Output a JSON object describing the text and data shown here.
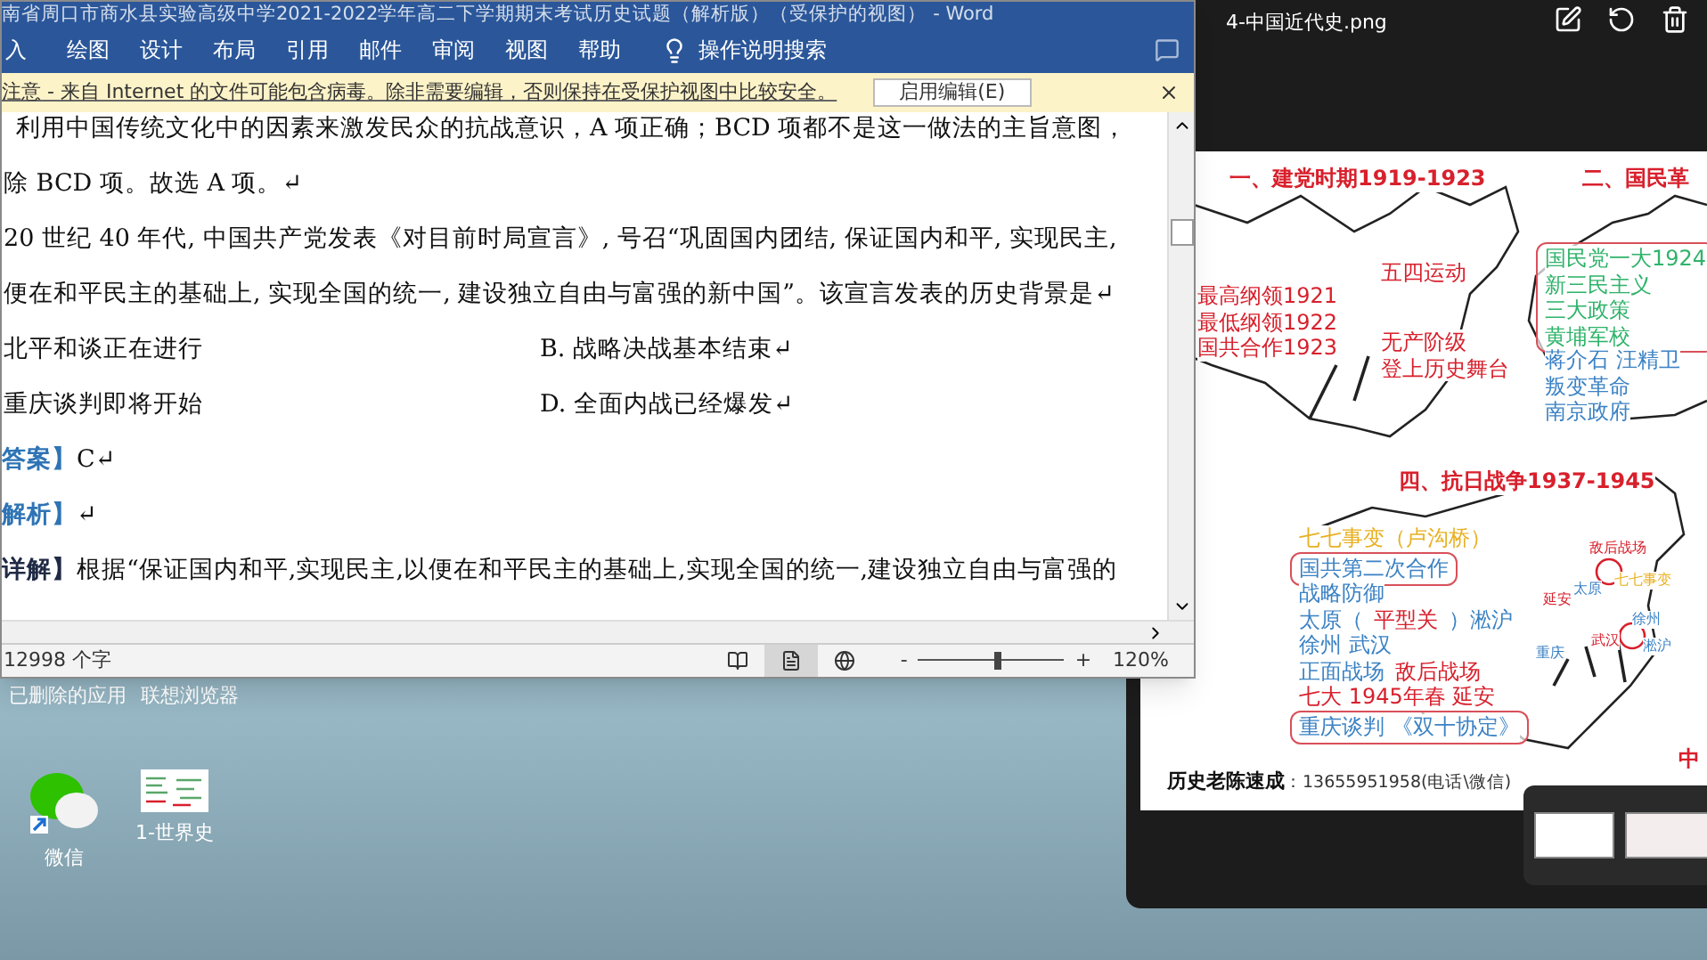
{
  "word_window": {
    "title": "南省周口市商水县实验高级中学2021-2022学年高二下学期期末考试历史试题（解析版）（受保护的视图） - Word",
    "ribbon_tabs": [
      "入",
      "绘图",
      "设计",
      "布局",
      "引用",
      "邮件",
      "审阅",
      "视图",
      "帮助"
    ],
    "search_label": "操作说明搜索",
    "protected_bar": {
      "message": "注意 - 来自 Internet 的文件可能包含病毒。除非需要编辑，否则保持在受保护视图中比较安全。",
      "button": "启用编辑(E)"
    },
    "document": {
      "lines": [
        {
          "kind": "text",
          "text": "利用中国传统文化中的因素来激发民众的抗战意识，A 项正确；BCD 项都不是这一做法的主旨意图，"
        },
        {
          "kind": "text",
          "text": "除 BCD 项。故选 A 项。↵"
        },
        {
          "kind": "text",
          "text": "20 世纪 40 年代, 中国共产党发表《对目前时局宣言》, 号召“巩固国内团结, 保证国内和平, 实现民主,"
        },
        {
          "kind": "text",
          "text": "便在和平民主的基础上, 实现全国的统一, 建设独立自由与富强的新中国”。该宣言发表的历史背景是↵"
        },
        {
          "kind": "options",
          "left": "北平和谈正在进行",
          "right": "B. 战略决战基本结束↵"
        },
        {
          "kind": "options",
          "left": "重庆谈判即将开始",
          "right": "D. 全面内战已经爆发↵"
        },
        {
          "kind": "labeled",
          "label": "答案】",
          "color": "#2e74b5",
          "text": "C↵"
        },
        {
          "kind": "labeled",
          "label": "解析】",
          "color": "#2e74b5",
          "text": "↵"
        },
        {
          "kind": "labeled",
          "label": "详解】",
          "color": "#1f2a44",
          "text": "根据“保证国内和平,实现民主,以便在和平民主的基础上,实现全国的统一,建设独立自由与富强的"
        }
      ]
    },
    "status_bar": {
      "word_count": "12998 个字",
      "views": [
        {
          "selected": false
        },
        {
          "selected": true
        },
        {
          "selected": false
        }
      ],
      "zoom_minus": "-",
      "zoom": {
        "level": 0.54
      },
      "zoom_plus": "+",
      "zoom_reading": "120%"
    }
  },
  "desktop": {
    "top_labels": [
      "已删除的应用",
      "联想浏览器"
    ],
    "icons": [
      {
        "kind": "chat",
        "label": "微信"
      },
      {
        "kind": "thumbnail",
        "label": "1-世界史"
      }
    ]
  },
  "photo_viewer": {
    "title": "4-中国近代史.png",
    "image": {
      "groups": [
        {
          "kind": "title",
          "lines": [
            [
              {
                "text": "一、建党时期1919-1923",
                "color": "#d8202c"
              }
            ]
          ]
        },
        {
          "kind": "title",
          "lines": [
            [
              {
                "text": "二、国民革",
                "color": "#d8202c"
              }
            ]
          ]
        },
        {
          "kind": "plain",
          "lines": [
            [
              {
                "text": "五四运动",
                "color": "#d8202c"
              }
            ]
          ]
        },
        {
          "kind": "plain",
          "lines": [
            [
              {
                "text": "最高纲领1921",
                "color": "#d8202c"
              }
            ],
            [
              {
                "text": "最低纲领1922",
                "color": "#d8202c"
              }
            ],
            [
              {
                "text": "国共合作1923",
                "color": "#d8202c"
              }
            ]
          ]
        },
        {
          "kind": "plain",
          "lines": [
            [
              {
                "text": "无产阶级",
                "color": "#d8202c"
              }
            ],
            [
              {
                "text": "登上历史舞台",
                "color": "#d8202c"
              }
            ]
          ]
        },
        {
          "kind": "boxed",
          "lines": [
            [
              {
                "text": "国民党一大1924",
                "color": "#2fb36a"
              }
            ],
            [
              {
                "text": "新三民主义",
                "color": "#2fb36a"
              }
            ],
            [
              {
                "text": "三大政策",
                "color": "#2fb36a"
              }
            ],
            [
              {
                "text": "黄埔军校",
                "color": "#2fb36a"
              }
            ]
          ]
        },
        {
          "kind": "plain",
          "lines": [
            [
              {
                "text": "蒋介石 汪精卫",
                "color": "#3b82c4"
              }
            ],
            [
              {
                "text": "叛变革命",
                "color": "#3b82c4"
              }
            ],
            [
              {
                "text": "南京政府",
                "color": "#3b82c4"
              }
            ]
          ]
        },
        {
          "kind": "title",
          "lines": [
            [
              {
                "text": "四、抗日战争1937-1945",
                "color": "#d8202c"
              }
            ]
          ]
        },
        {
          "kind": "plain",
          "lines": [
            [
              {
                "text": "七七事变（卢沟桥）",
                "color": "#e8b020"
              }
            ]
          ]
        },
        {
          "kind": "boxed",
          "lines": [
            [
              {
                "text": "国共第二次合作",
                "color": "#3b82c4"
              }
            ]
          ]
        },
        {
          "kind": "plain",
          "lines": [
            [
              {
                "text": "战略防御",
                "color": "#3b82c4"
              }
            ],
            [
              {
                "text": "太原（",
                "color": "#3b82c4"
              },
              {
                "text": "平型关",
                "color": "#d8202c"
              },
              {
                "text": "）淞沪",
                "color": "#3b82c4"
              }
            ],
            [
              {
                "text": "徐州  武汉",
                "color": "#3b82c4"
              }
            ],
            [
              {
                "text": "正面战场",
                "color": "#3b82c4"
              },
              {
                "text": "敌后战场",
                "color": "#d8202c"
              }
            ],
            [
              {
                "text": "七大  1945年春  延安",
                "color": "#d8202c"
              }
            ]
          ]
        },
        {
          "kind": "boxed",
          "lines": [
            [
              {
                "text": "重庆谈判  《双十协定》",
                "color": "#3b82c4"
              }
            ]
          ]
        },
        {
          "kind": "small",
          "lines": [
            [
              {
                "text": "敌后战场",
                "color": "#d8202c"
              }
            ]
          ]
        },
        {
          "kind": "small",
          "lines": [
            [
              {
                "text": "太原",
                "color": "#3b82c4"
              }
            ]
          ]
        },
        {
          "kind": "small",
          "lines": [
            [
              {
                "text": "延安",
                "color": "#d8202c"
              }
            ]
          ]
        },
        {
          "kind": "small",
          "lines": [
            [
              {
                "text": "七七事变",
                "color": "#e8b020"
              }
            ]
          ]
        },
        {
          "kind": "small",
          "lines": [
            [
              {
                "text": "徐州",
                "color": "#3b82c4"
              }
            ]
          ]
        },
        {
          "kind": "small",
          "lines": [
            [
              {
                "text": "武汉",
                "color": "#d8202c"
              }
            ]
          ]
        },
        {
          "kind": "small",
          "lines": [
            [
              {
                "text": "重庆",
                "color": "#3b82c4"
              }
            ]
          ]
        },
        {
          "kind": "small",
          "lines": [
            [
              {
                "text": "淞沪",
                "color": "#3b82c4"
              }
            ]
          ]
        },
        {
          "kind": "title",
          "lines": [
            [
              {
                "text": "中",
                "color": "#d8202c"
              }
            ]
          ]
        }
      ],
      "footer": {
        "author": "历史老陈速成",
        "contact": "：13655951958(电话\\微信)"
      }
    }
  }
}
